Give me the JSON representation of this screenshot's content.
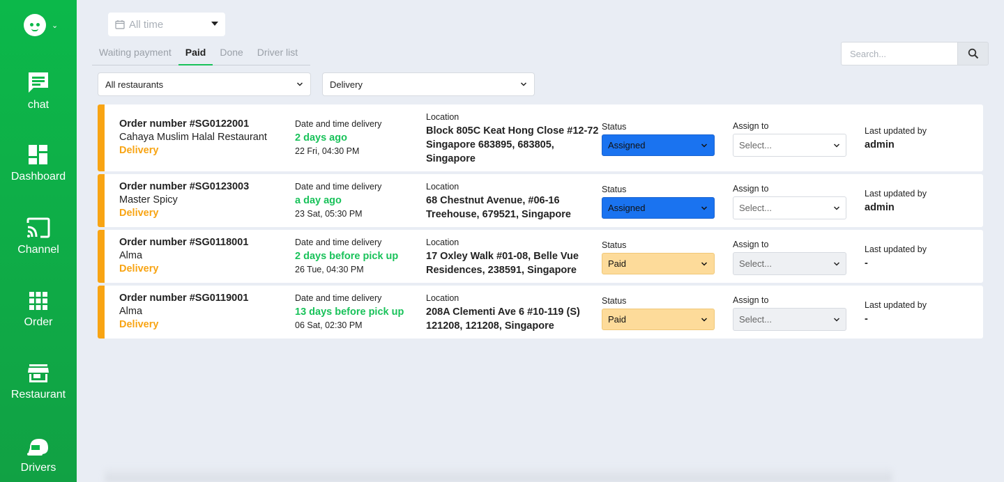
{
  "sidebar": {
    "items": [
      {
        "label": "chat",
        "icon": "chat-icon"
      },
      {
        "label": "Dashboard",
        "icon": "dashboard-icon"
      },
      {
        "label": "Channel",
        "icon": "channel-icon"
      },
      {
        "label": "Order",
        "icon": "order-icon"
      },
      {
        "label": "Restaurant",
        "icon": "restaurant-icon"
      },
      {
        "label": "Drivers",
        "icon": "drivers-icon"
      }
    ]
  },
  "date_filter": {
    "value": "All time"
  },
  "tabs": [
    {
      "label": "Waiting payment",
      "active": false
    },
    {
      "label": "Paid",
      "active": true
    },
    {
      "label": "Done",
      "active": false
    },
    {
      "label": "Driver list",
      "active": false
    }
  ],
  "search": {
    "placeholder": "Search..."
  },
  "filters": {
    "restaurant": "All restaurants",
    "delivery_type": "Delivery"
  },
  "labels": {
    "date_time": "Date and time delivery",
    "location": "Location",
    "status": "Status",
    "assign_to": "Assign to",
    "last_updated": "Last updated by"
  },
  "orders": [
    {
      "order_number": "Order number #SG0122001",
      "restaurant": "Cahaya Muslim Halal Restaurant",
      "type": "Delivery",
      "relative_time": "2 days ago",
      "datetime": "22 Fri, 04:30 PM",
      "location": [
        "Block 805C Keat Hong Close #12-72",
        "Singapore 683895, 683805,",
        "Singapore"
      ],
      "status": "Assigned",
      "assign_to": "Select...",
      "updated_by": "admin"
    },
    {
      "order_number": "Order number #SG0123003",
      "restaurant": "Master Spicy",
      "type": "Delivery",
      "relative_time": "a day ago",
      "datetime": "23 Sat, 05:30 PM",
      "location": [
        "68 Chestnut Avenue, #06-16",
        "Treehouse, 679521, Singapore"
      ],
      "status": "Assigned",
      "assign_to": "Select...",
      "updated_by": "admin"
    },
    {
      "order_number": "Order number #SG0118001",
      "restaurant": "Alma",
      "type": "Delivery",
      "relative_time": "2 days before pick up",
      "datetime": "26 Tue, 04:30 PM",
      "location": [
        "17 Oxley Walk #01-08, Belle Vue",
        "Residences, 238591, Singapore"
      ],
      "status": "Paid",
      "assign_to": "Select...",
      "updated_by": "-"
    },
    {
      "order_number": "Order number #SG0119001",
      "restaurant": "Alma",
      "type": "Delivery",
      "relative_time": "13 days before pick up",
      "datetime": "06 Sat, 02:30 PM",
      "location": [
        "208A Clementi Ave 6 #10-119 (S)",
        "121208, 121208, Singapore"
      ],
      "status": "Paid",
      "assign_to": "Select...",
      "updated_by": "-"
    }
  ],
  "colors": {
    "brand_green": "#0cb84a",
    "accent_orange": "#f8a413",
    "assigned_blue": "#1a73f0",
    "paid_peach": "#fddb9a",
    "relative_green": "#19c25a"
  }
}
